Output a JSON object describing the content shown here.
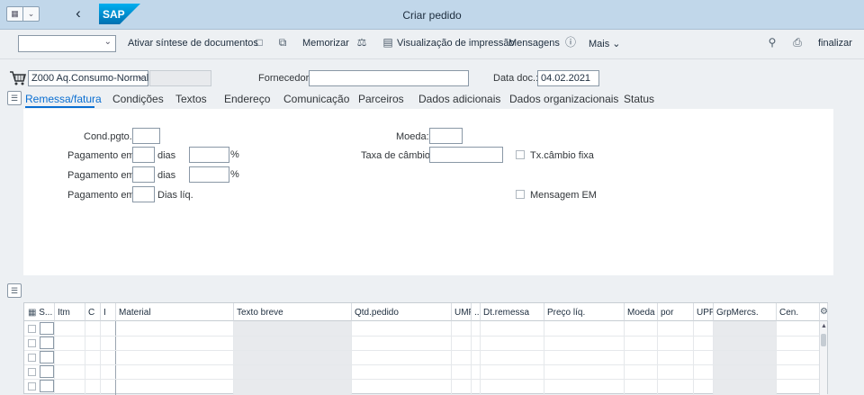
{
  "titlebar": {
    "title": "Criar pedido",
    "brand": "SAP",
    "brand_color": "#0a6ed1"
  },
  "toolbar": {
    "dropdown_value": "",
    "items": {
      "doc_overview": "Ativar síntese de documentos",
      "hold": "Memorizar",
      "print_preview": "Visualização de impressão",
      "messages": "Mensagens",
      "more": "Mais",
      "finish": "finalizar"
    },
    "icons": [
      "new-doc-icon",
      "copy-doc-icon",
      "balance-icon",
      "print-preview-icon",
      "info-icon",
      "search-icon",
      "printer-icon"
    ]
  },
  "header": {
    "order_type": "Z000 Aq.Consumo-Normal",
    "supplier_label": "Fornecedor:",
    "supplier_value": "",
    "doc_date_label": "Data doc.:",
    "doc_date_value": "04.02.2021"
  },
  "tabs": [
    {
      "label": "Remessa/fatura",
      "active": true
    },
    {
      "label": "Condições"
    },
    {
      "label": "Textos"
    },
    {
      "label": "Endereço"
    },
    {
      "label": "Comunicação"
    },
    {
      "label": "Parceiros"
    },
    {
      "label": "Dados adicionais"
    },
    {
      "label": "Dados organizacionais"
    },
    {
      "label": "Status"
    }
  ],
  "delivery": {
    "payment_terms_label": "Cond.pgto.:",
    "payment_in_label": "Pagamento em:",
    "days_label": "dias",
    "percent_sign": "%",
    "net_days_label": "Dias líq.",
    "currency_label": "Moeda:",
    "exchange_rate_label": "Taxa de câmbio:",
    "fixed_rate_label": "Tx.câmbio fixa",
    "gr_message_label": "Mensagem EM"
  },
  "grid": {
    "columns": [
      "S...",
      "Itm",
      "C",
      "I",
      "Material",
      "Texto breve",
      "Qtd.pedido",
      "UMP",
      "...",
      "Dt.remessa",
      "Preço líq.",
      "Moeda",
      "por",
      "UPP",
      "GrpMercs.",
      "Cen."
    ]
  }
}
